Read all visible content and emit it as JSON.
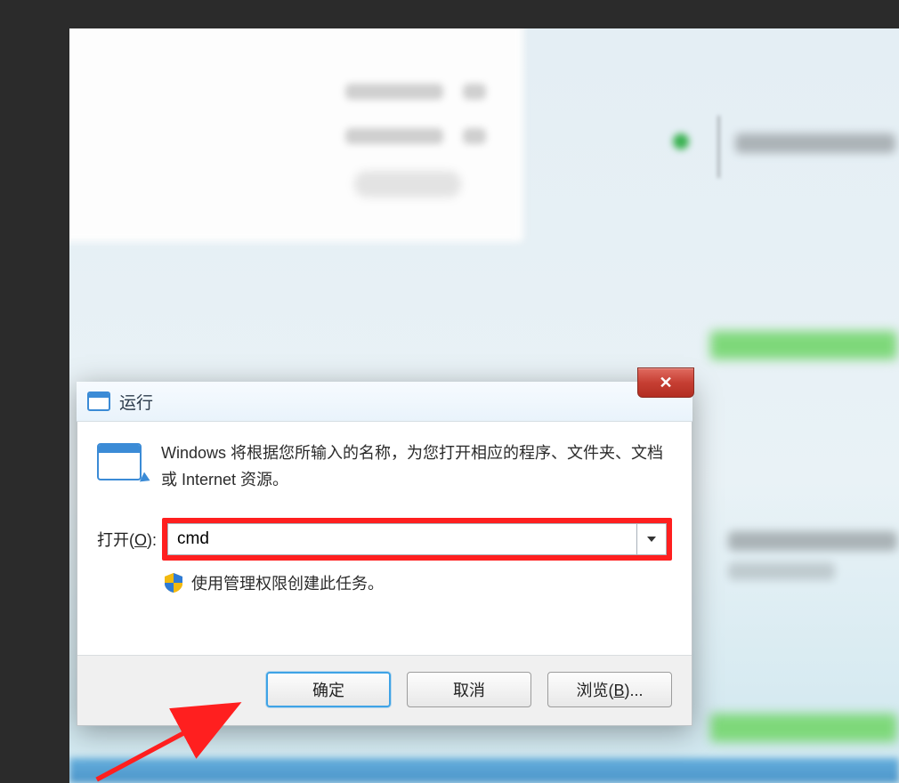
{
  "dialog": {
    "title": "运行",
    "close_symbol": "✕",
    "description": "Windows 将根据您所输入的名称，为您打开相应的程序、文件夹、文档或 Internet 资源。",
    "open_label_prefix": "打开(",
    "open_label_hotkey": "O",
    "open_label_suffix": "):",
    "input_value": "cmd",
    "admin_note": "使用管理权限创建此任务。",
    "buttons": {
      "ok": "确定",
      "cancel": "取消",
      "browse_prefix": "浏览(",
      "browse_hotkey": "B",
      "browse_suffix": ")..."
    }
  }
}
